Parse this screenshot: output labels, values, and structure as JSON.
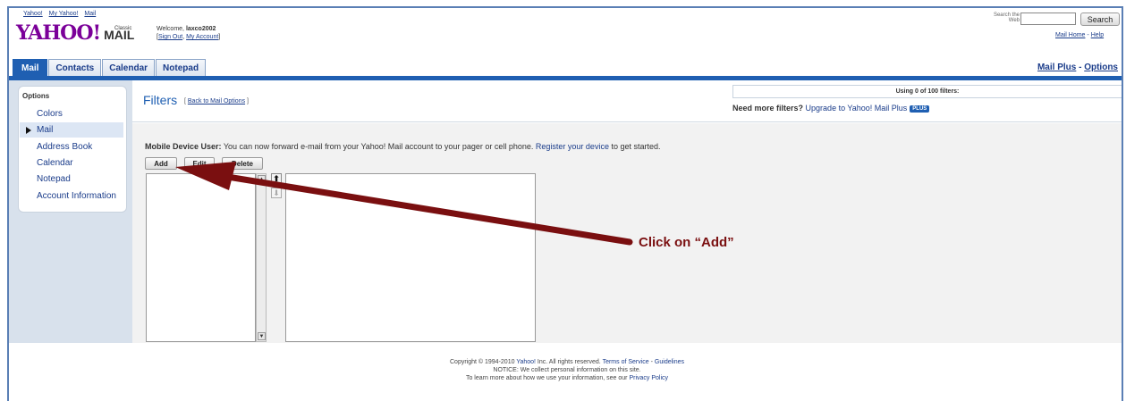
{
  "top_links": [
    "Yahoo!",
    "My Yahoo!",
    "Mail"
  ],
  "logo": {
    "brand": "YAHOO!",
    "product": "MAIL",
    "edition": "Classic"
  },
  "welcome": {
    "prefix": "Welcome, ",
    "username": "laxco2002",
    "sign_out": "Sign Out",
    "separator": ", ",
    "my_account": "My Account",
    "open": "[",
    "close": "]"
  },
  "search": {
    "label": "Search the Web",
    "button": "Search"
  },
  "header_links": {
    "mail_home": "Mail Home",
    "sep": " - ",
    "help": "Help"
  },
  "tabs": [
    {
      "label": "Mail",
      "active": true
    },
    {
      "label": "Contacts",
      "active": false
    },
    {
      "label": "Calendar",
      "active": false
    },
    {
      "label": "Notepad",
      "active": false
    }
  ],
  "mail_plus": {
    "mail_plus": "Mail Plus",
    "sep": " - ",
    "options": "Options"
  },
  "sidebar": {
    "title": "Options",
    "items": [
      {
        "label": "Colors",
        "selected": false
      },
      {
        "label": "Mail",
        "selected": true
      },
      {
        "label": "Address Book",
        "selected": false
      },
      {
        "label": "Calendar",
        "selected": false
      },
      {
        "label": "Notepad",
        "selected": false
      },
      {
        "label": "Account Information",
        "selected": false
      }
    ]
  },
  "filters": {
    "title": "Filters",
    "back_open": "[ ",
    "back_link": "Back to Mail Options",
    "back_close": " ]",
    "usage": "Using 0 of 100 filters:",
    "more_bold": "Need more filters?",
    "upgrade_link": "Upgrade to Yahoo! Mail Plus",
    "plus_badge": "PLUS"
  },
  "mobile_note": {
    "bold": "Mobile Device User:",
    "text": " You can now forward e-mail from your Yahoo! Mail account to your pager or cell phone. ",
    "link": "Register your device",
    "suffix": " to get started."
  },
  "buttons": {
    "add": "Add",
    "edit": "Edit",
    "delete": "Delete"
  },
  "icons": {
    "scroll_up": "▲",
    "scroll_down": "▼",
    "order_up": "⬆",
    "order_down": "⬇"
  },
  "footer": {
    "line1_prefix": "Copyright © 1994-2010 ",
    "yahoo_link": "Yahoo!",
    "line1_mid": " Inc. All rights reserved. ",
    "terms_link": "Terms of Service",
    "line1_sep": " - ",
    "guidelines_link": "Guidelines",
    "line2": "NOTICE: We collect personal information on this site.",
    "line3_prefix": "To learn more about how we use your information, see our ",
    "privacy_link": "Privacy Policy"
  },
  "annotation": {
    "text": "Click on “Add”",
    "color": "#7a0f10"
  },
  "colors": {
    "brand_purple": "#7b0099",
    "accent_blue": "#1f5fb2",
    "link_blue": "#1a3c8a",
    "sidebar_bg": "#d8e1ec"
  }
}
